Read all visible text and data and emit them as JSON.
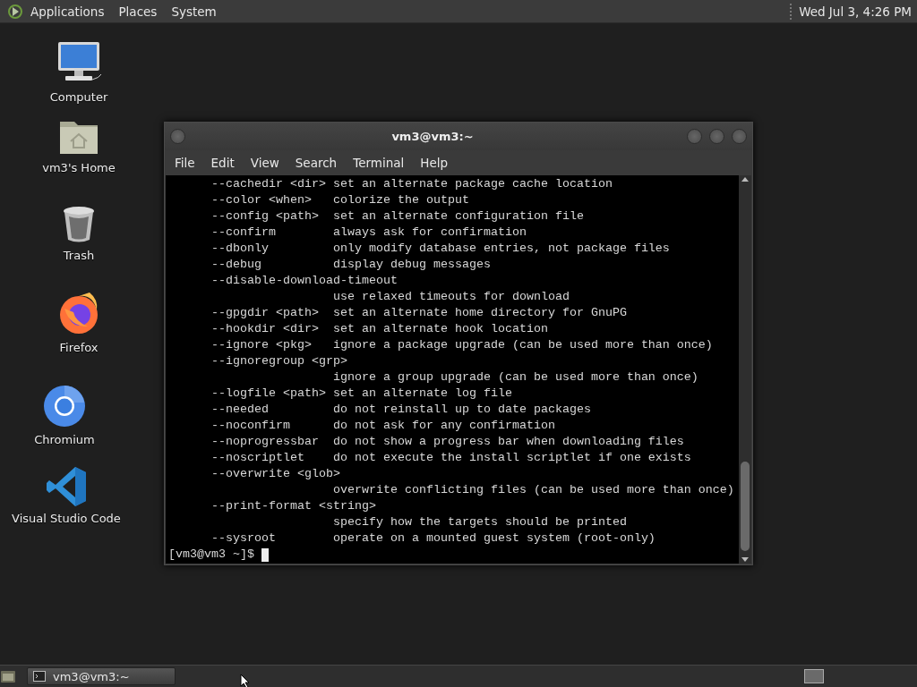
{
  "top_panel": {
    "menus": [
      "Applications",
      "Places",
      "System"
    ],
    "clock": "Wed Jul 3, 4:26 PM"
  },
  "desktop_icons": [
    {
      "label": "Computer",
      "kind": "computer"
    },
    {
      "label": "vm3's Home",
      "kind": "home"
    },
    {
      "label": "Trash",
      "kind": "trash"
    },
    {
      "label": "Firefox",
      "kind": "firefox"
    },
    {
      "label": "Chromium",
      "kind": "chromium"
    },
    {
      "label": "Visual Studio Code",
      "kind": "vscode"
    }
  ],
  "terminal": {
    "title": "vm3@vm3:~",
    "menu": [
      "File",
      "Edit",
      "View",
      "Search",
      "Terminal",
      "Help"
    ],
    "lines": [
      {
        "option": "--cachedir <dir>",
        "description": "set an alternate package cache location"
      },
      {
        "option": "--color <when>",
        "description": "colorize the output"
      },
      {
        "option": "--config <path>",
        "description": "set an alternate configuration file"
      },
      {
        "option": "--confirm",
        "description": "always ask for confirmation"
      },
      {
        "option": "--dbonly",
        "description": "only modify database entries, not package files"
      },
      {
        "option": "--debug",
        "description": "display debug messages"
      },
      {
        "option": "--disable-download-timeout"
      },
      {
        "description": "use relaxed timeouts for download"
      },
      {
        "option": "--gpgdir <path>",
        "description": "set an alternate home directory for GnuPG"
      },
      {
        "option": "--hookdir <dir>",
        "description": "set an alternate hook location"
      },
      {
        "option": "--ignore <pkg>",
        "description": "ignore a package upgrade (can be used more than once)"
      },
      {
        "option": "--ignoregroup <grp>"
      },
      {
        "description": "ignore a group upgrade (can be used more than once)"
      },
      {
        "option": "--logfile <path>",
        "description": "set an alternate log file"
      },
      {
        "option": "--needed",
        "description": "do not reinstall up to date packages"
      },
      {
        "option": "--noconfirm",
        "description": "do not ask for any confirmation"
      },
      {
        "option": "--noprogressbar",
        "description": "do not show a progress bar when downloading files"
      },
      {
        "option": "--noscriptlet",
        "description": "do not execute the install scriptlet if one exists"
      },
      {
        "option": "--overwrite <glob>"
      },
      {
        "description": "overwrite conflicting files (can be used more than once)"
      },
      {
        "option": "--print-format <string>"
      },
      {
        "description": "specify how the targets should be printed"
      },
      {
        "option": "--sysroot",
        "description": "operate on a mounted guest system (root-only)"
      }
    ],
    "prompt": "[vm3@vm3 ~]$"
  },
  "taskbar": {
    "tasks": [
      {
        "label": "vm3@vm3:~"
      }
    ]
  }
}
